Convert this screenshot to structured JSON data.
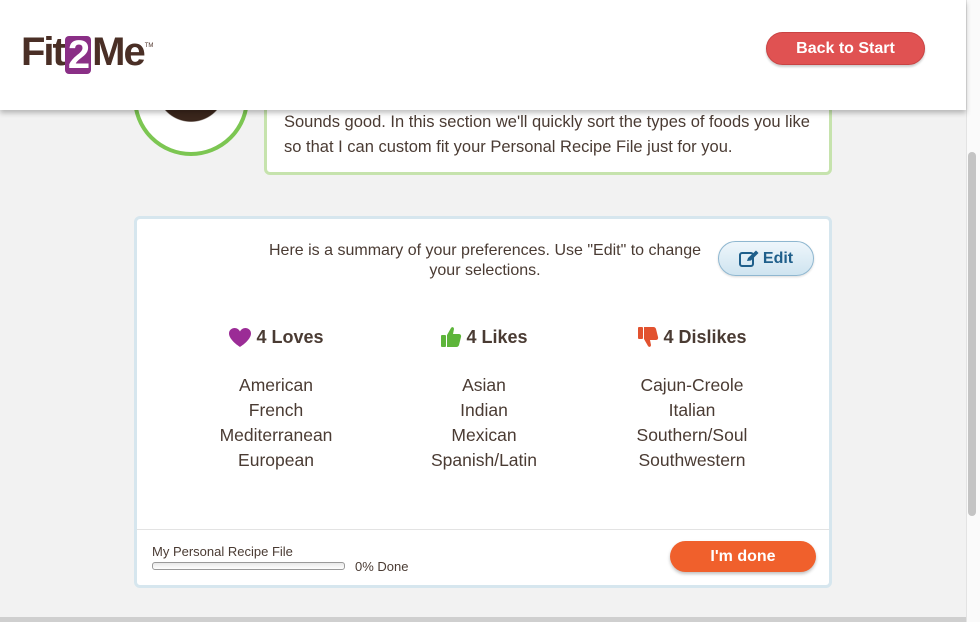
{
  "brand": {
    "logo_left": "Fit",
    "logo_mid": "2",
    "logo_right": "Me",
    "logo_tm": "TM",
    "accent": "#8a2f86"
  },
  "header": {
    "back_label": "Back to Start"
  },
  "coach": {
    "message": "Sounds good. In this section we'll quickly sort the types of foods you like so that I can custom fit your Personal Recipe File just for you."
  },
  "summary": {
    "text": "Here is a summary of your preferences. Use \"Edit\" to change your selections.",
    "edit_label": "Edit"
  },
  "columns": {
    "loves": {
      "icon": "heart-icon",
      "title": "4 Loves",
      "items": [
        "American",
        "French",
        "Mediterranean",
        "European"
      ]
    },
    "likes": {
      "icon": "thumbs-up-icon",
      "title": "4 Likes",
      "items": [
        "Asian",
        "Indian",
        "Mexican",
        "Spanish/Latin"
      ]
    },
    "dislikes": {
      "icon": "thumbs-down-icon",
      "title": "4 Dislikes",
      "items": [
        "Cajun-Creole",
        "Italian",
        "Southern/Soul",
        "Southwestern"
      ]
    }
  },
  "progress": {
    "label": "My Personal Recipe File",
    "percent": 0,
    "percent_label": "0% Done"
  },
  "footer": {
    "done_label": "I'm done"
  },
  "colors": {
    "heart": "#9b2c96",
    "like": "#5db53a",
    "dislike": "#e2522f",
    "done": "#f0602c",
    "back": "#e05252"
  }
}
